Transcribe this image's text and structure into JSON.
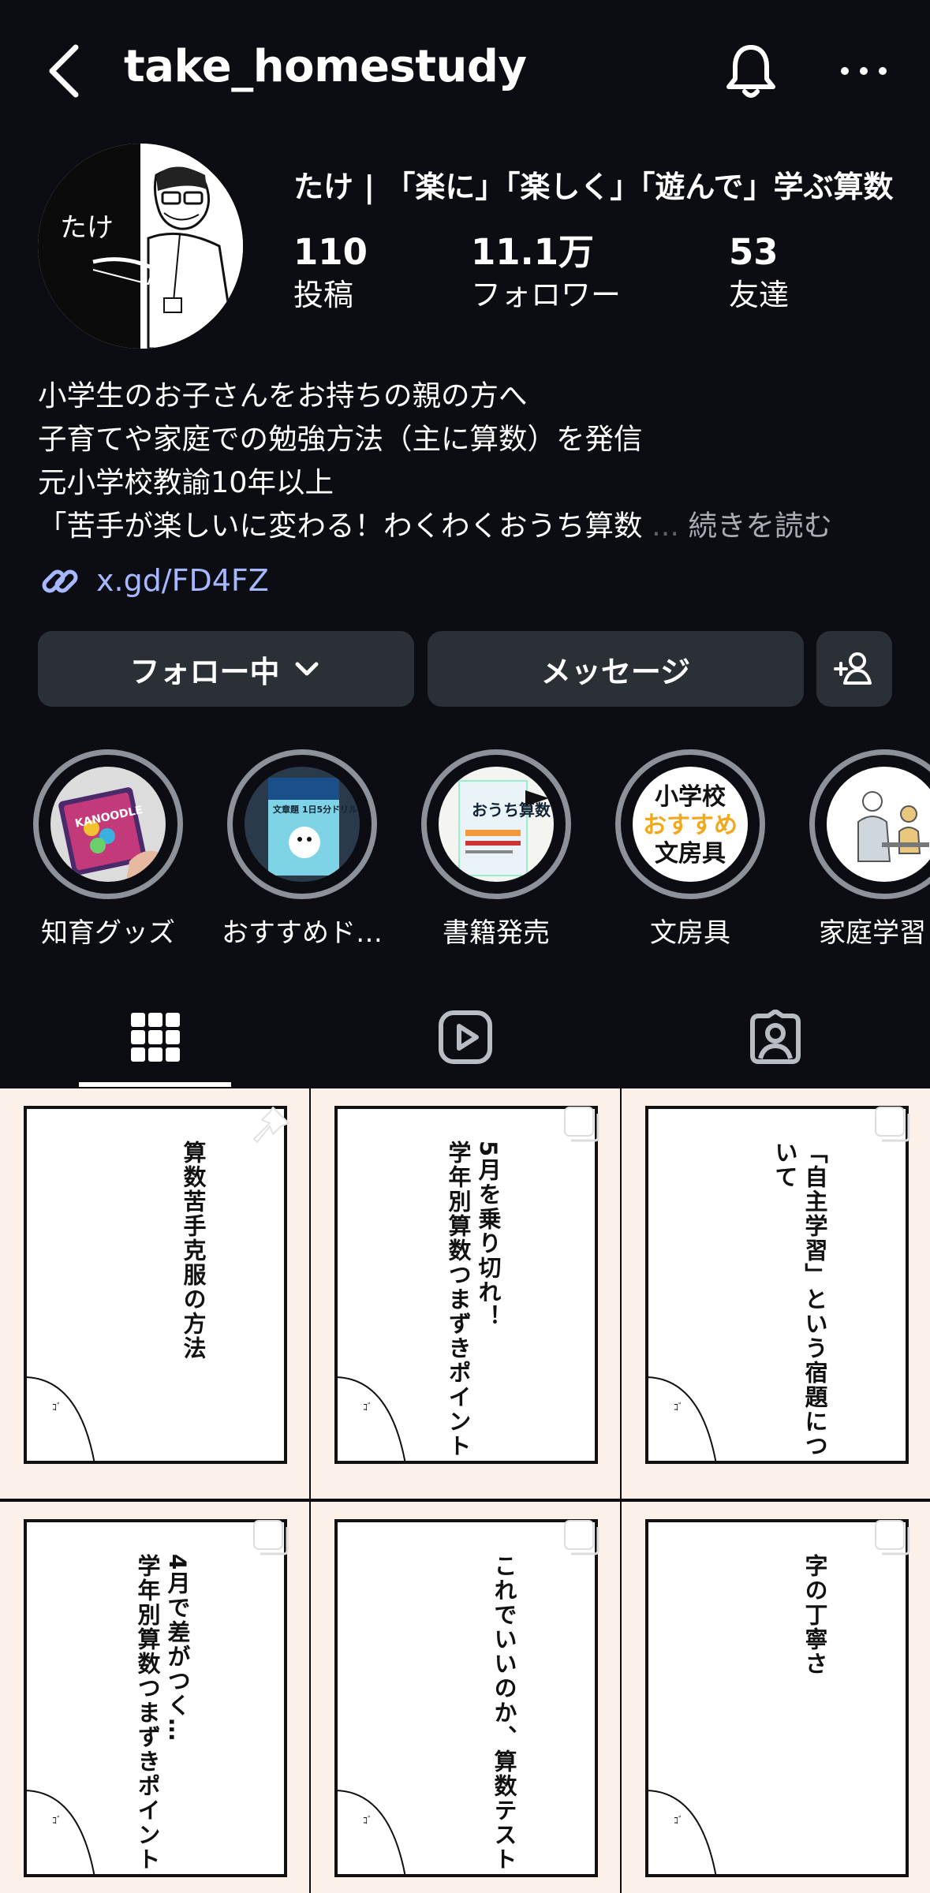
{
  "header": {
    "username": "take_homestudy"
  },
  "profile": {
    "display_name": "たけ | 「楽に」「楽しく」「遊んで」学ぶ算数",
    "avatar_text": "たけ",
    "stats": [
      {
        "value": "110",
        "label": "投稿"
      },
      {
        "value": "11.1万",
        "label": "フォロワー"
      },
      {
        "value": "53",
        "label": "友達"
      }
    ],
    "bio": [
      "小学生のお子さんをお持ちの親の方へ",
      "子育てや家庭での勉強方法（主に算数）を発信",
      "元小学校教諭10年以上",
      "「苦手が楽しいに変わる！わくわくおうち算数"
    ],
    "bio_ellipsis": "...",
    "bio_more": "続きを読む",
    "link": "x.gd/FD4FZ"
  },
  "actions": {
    "follow_label": "フォロー中",
    "message_label": "メッセージ"
  },
  "highlights": [
    {
      "label": "知育グッズ",
      "image_text": "KANOODLE"
    },
    {
      "label": "おすすめド…",
      "image_text": "文章題 1日5分ドリル"
    },
    {
      "label": "書籍発売",
      "image_text": "おうち算数"
    },
    {
      "label": "文房具",
      "image_lines": [
        "小学校",
        "おすすめ",
        "文房具"
      ]
    },
    {
      "label": "家庭学習"
    }
  ],
  "posts": [
    {
      "title": "算数苦手克服の方法",
      "badge": "pin-icon"
    },
    {
      "title": "5月を乗り切れ！\n学年別算数つまずきポイント",
      "badge": "carousel-icon"
    },
    {
      "title": "「自主学習」という宿題について",
      "badge": "carousel-icon"
    },
    {
      "title": "4月で差がつく…\n学年別算数つまずきポイント",
      "badge": "carousel-icon"
    },
    {
      "title": "これでいいのか、算数テスト",
      "badge": "carousel-icon"
    },
    {
      "title": "字の丁寧さ",
      "badge": "carousel-icon"
    }
  ],
  "colors": {
    "background": "#0b0d12",
    "button": "#2b2f36",
    "link": "#a6b8ff",
    "tile_bg": "#fbf1e9"
  }
}
